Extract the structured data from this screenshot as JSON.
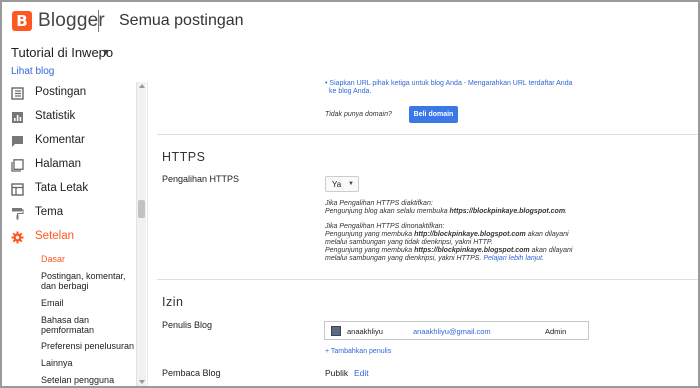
{
  "header": {
    "brand": "Blogger",
    "section_title": "Semua postingan"
  },
  "blog": {
    "name": "Tutorial di Inwepo",
    "view_blog": "Lihat blog"
  },
  "sidebar": {
    "items": [
      {
        "label": "Postingan",
        "icon": "posts-icon"
      },
      {
        "label": "Statistik",
        "icon": "stats-icon"
      },
      {
        "label": "Komentar",
        "icon": "comment-icon"
      },
      {
        "label": "Halaman",
        "icon": "pages-icon"
      },
      {
        "label": "Tata Letak",
        "icon": "layout-icon"
      },
      {
        "label": "Tema",
        "icon": "paint-roller-icon"
      },
      {
        "label": "Setelan",
        "icon": "gear-icon",
        "active": true
      }
    ],
    "subitems": [
      "Dasar",
      "Postingan, komentar, dan berbagi",
      "Email",
      "Bahasa dan pemformatan",
      "Preferensi penelusuran",
      "Lainnya",
      "Setelan pengguna"
    ],
    "active_color": "#ff5722"
  },
  "domain": {
    "cut_text_1": "• Siapkan URL pihak ketiga untuk blog Anda - Mengarahkan URL terdaftar Anda",
    "cut_text_2": "ke blog Anda.",
    "no_domain": "Tidak punya domain?",
    "buy_button": "Beli domain"
  },
  "https": {
    "heading": "HTTPS",
    "redirect_label": "Pengalihan HTTPS",
    "redirect_value": "Ya",
    "enabled_title": "Jika Pengalihan HTTPS diaktifkan:",
    "enabled_text_pre": "Pengunjung blog akan selalu membuka ",
    "enabled_url": "https://blockpinkaye.blogspot.com",
    "enabled_text_post": ".",
    "disabled_title": "Jika Pengalihan HTTPS dinonaktifkan:",
    "disabled_l1_pre": "Pengunjung yang membuka ",
    "disabled_l1_url": "http://blockpinkaye.blogspot.com",
    "disabled_l1_post": " akan dilayani",
    "disabled_l2": "melalui sambungan yang tidak dienkripsi, yakni HTTP.",
    "disabled_l3_pre": "Pengunjung yang membuka ",
    "disabled_l3_url": "https://blockpinkaye.blogspot.com",
    "disabled_l3_post": " akan dilayani",
    "disabled_l4": "melalui sambungan yang dienkripsi, yakni HTTPS.",
    "learn_more": "Pelajari lebih lanjut."
  },
  "permissions": {
    "heading": "Izin",
    "writers_label": "Penulis Blog",
    "writer": {
      "name": "anaakhliyu",
      "email": "anaakhliyu@gmail.com",
      "role": "Admin"
    },
    "add_writer": "+ Tambahkan penulis",
    "readers_label": "Pembaca Blog",
    "readers_value": "Publik",
    "readers_edit": "Edit"
  },
  "colors": {
    "brand": "#ff5722",
    "primary_button": "#3b78e7",
    "link": "#3367d6"
  }
}
